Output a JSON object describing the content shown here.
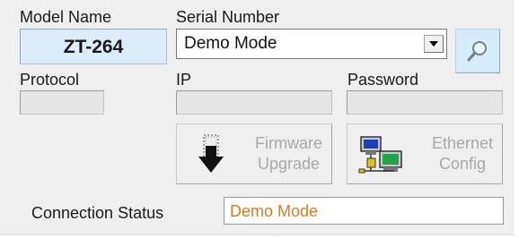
{
  "labels": {
    "model_name": "Model Name",
    "serial_number": "Serial Number",
    "protocol": "Protocol",
    "ip": "IP",
    "password": "Password",
    "connection_status": "Connection Status"
  },
  "model": {
    "value": "ZT-264"
  },
  "serial": {
    "selected": "Demo Mode",
    "arrow_icon": "chevron-down-icon"
  },
  "search_button": {
    "icon": "magnifier-icon"
  },
  "fields": {
    "protocol": "",
    "ip": "",
    "password": ""
  },
  "buttons": {
    "firmware": {
      "line1": "Firmware",
      "line2": "Upgrade",
      "icon": "download-arrow-icon",
      "enabled": false
    },
    "ethernet": {
      "line1": "Ethernet",
      "line2": "Config",
      "icon": "network-computers-icon",
      "enabled": false
    }
  },
  "status": {
    "value": "Demo Mode",
    "color": "#e07a1e"
  },
  "colors": {
    "panel": "#efefef",
    "model_box": "#dcecf8",
    "search_button": "#d6ecf8",
    "disabled_text": "#a9a9a9"
  }
}
